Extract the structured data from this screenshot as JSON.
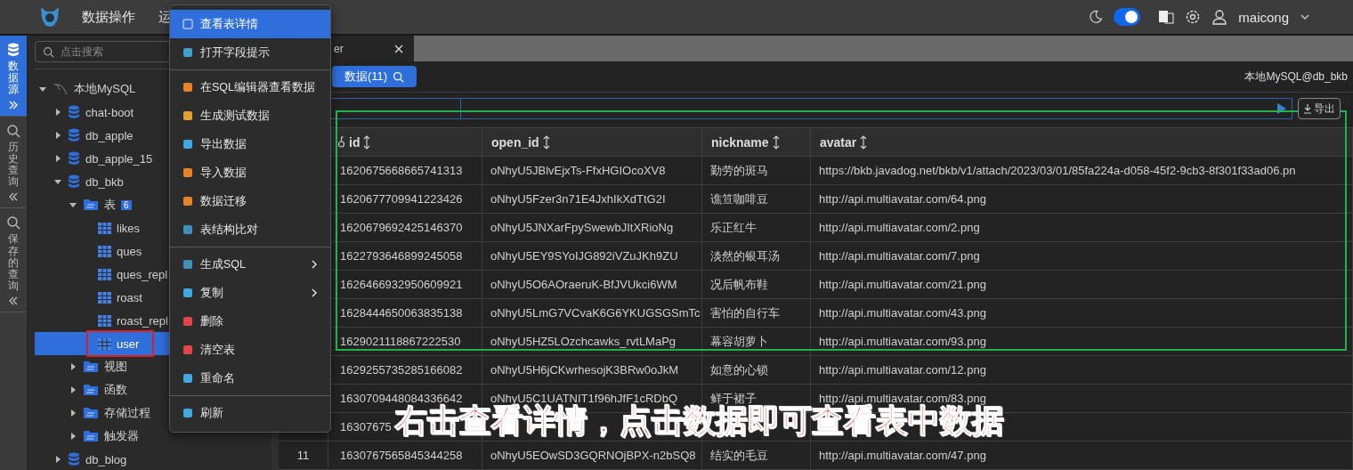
{
  "top_bar": {
    "menu": [
      "数据操作",
      "运"
    ],
    "dark_mode": {
      "on": true
    },
    "user": "maicong"
  },
  "rail": {
    "tabs": [
      {
        "label": "数据源",
        "selected": true
      },
      {
        "label": "历史查询",
        "selected": false
      },
      {
        "label": "保存的查询",
        "selected": false
      }
    ]
  },
  "sidebar": {
    "search": {
      "placeholder": "点击搜索"
    },
    "tree": [
      {
        "label": "本地MySQL",
        "kind": "connection",
        "expanded": true,
        "selected": false,
        "children": [
          {
            "label": "chat-boot",
            "kind": "database",
            "expanded": false,
            "selected": false
          },
          {
            "label": "db_apple",
            "kind": "database",
            "expanded": false,
            "selected": false
          },
          {
            "label": "db_apple_15",
            "kind": "database",
            "expanded": false,
            "selected": false
          },
          {
            "label": "db_bkb",
            "kind": "database",
            "expanded": true,
            "selected": false,
            "children": [
              {
                "label": "表",
                "kind": "folder",
                "badge": "6",
                "expanded": true,
                "selected": false,
                "children": [
                  {
                    "label": "likes",
                    "kind": "table",
                    "selected": false
                  },
                  {
                    "label": "ques",
                    "kind": "table",
                    "selected": false
                  },
                  {
                    "label": "ques_repl",
                    "kind": "table",
                    "selected": false
                  },
                  {
                    "label": "roast",
                    "kind": "table",
                    "selected": false
                  },
                  {
                    "label": "roast_repl",
                    "kind": "table",
                    "selected": false
                  },
                  {
                    "label": "user",
                    "kind": "table",
                    "selected": true
                  }
                ]
              },
              {
                "label": "视图",
                "kind": "folder",
                "expanded": false,
                "selected": false
              },
              {
                "label": "函数",
                "kind": "folder",
                "expanded": false,
                "selected": false
              },
              {
                "label": "存储过程",
                "kind": "folder",
                "expanded": false,
                "selected": false
              },
              {
                "label": "触发器",
                "kind": "folder",
                "expanded": false,
                "selected": false
              }
            ]
          },
          {
            "label": "db_blog",
            "kind": "database",
            "expanded": false,
            "selected": false
          }
        ]
      }
    ]
  },
  "context_menu": {
    "groups": [
      [
        {
          "label": "查看表详情",
          "selected": true,
          "submenu": false
        },
        {
          "label": "打开字段提示",
          "selected": false,
          "submenu": false
        }
      ],
      [
        {
          "label": "在SQL编辑器查看数据",
          "selected": false,
          "submenu": false
        },
        {
          "label": "生成测试数据",
          "selected": false,
          "submenu": false
        },
        {
          "label": "导出数据",
          "selected": false,
          "submenu": false
        },
        {
          "label": "导入数据",
          "selected": false,
          "submenu": false
        },
        {
          "label": "数据迁移",
          "selected": false,
          "submenu": false
        },
        {
          "label": "表结构比对",
          "selected": false,
          "submenu": false
        }
      ],
      [
        {
          "label": "生成SQL",
          "selected": false,
          "submenu": true
        },
        {
          "label": "复制",
          "selected": false,
          "submenu": true
        },
        {
          "label": "删除",
          "selected": false,
          "submenu": false
        },
        {
          "label": "清空表",
          "selected": false,
          "submenu": false
        },
        {
          "label": "重命名",
          "selected": false,
          "submenu": false
        }
      ],
      [
        {
          "label": "刷新",
          "selected": false,
          "submenu": false
        }
      ]
    ]
  },
  "tab": {
    "label": "er"
  },
  "toolbar": {
    "data_button": "数据(11)",
    "connection": "本地MySQL@db_bkb",
    "export_button": "导出"
  },
  "table": {
    "columns": [
      {
        "label": "id",
        "key": true
      },
      {
        "label": "open_id",
        "key": false
      },
      {
        "label": "nickname",
        "key": false
      },
      {
        "label": "avatar",
        "key": false
      }
    ],
    "rows": [
      {
        "cells": [
          "1620675668665741313",
          "oNhyU5JBlvEjxTs-FfxHGIOcoXV8",
          "勤劳的斑马",
          "https://bkb.javadog.net/bkb/v1/attach/2023/03/01/85fa224a-d058-45f2-9cb3-8f301f33ad06.pn"
        ]
      },
      {
        "cells": [
          "1620677709941223426",
          "oNhyU5Fzer3n71E4JxhIkXdTtG2I",
          "谯笪咖啡豆",
          "http://api.multiavatar.com/64.png"
        ]
      },
      {
        "cells": [
          "1620679692425146370",
          "oNhyU5JNXarFpySwewbJItXRioNg",
          "乐正红牛",
          "http://api.multiavatar.com/2.png"
        ]
      },
      {
        "cells": [
          "1622793646899245058",
          "oNhyU5EY9SYoIJG892iVZuJKh9ZU",
          "淡然的银耳汤",
          "http://api.multiavatar.com/7.png"
        ]
      },
      {
        "cells": [
          "1626466932950609921",
          "oNhyU5O6AOraeruK-BfJVUkci6WM",
          "况后帆布鞋",
          "http://api.multiavatar.com/21.png"
        ]
      },
      {
        "cells": [
          "1628444650063835138",
          "oNhyU5LmG7VCvaK6G6YKUGSGSmTc",
          "害怕的自行车",
          "http://api.multiavatar.com/43.png"
        ]
      },
      {
        "cells": [
          "1629021118867222530",
          "oNhyU5HZ5LOzchcawks_rvtLMaPg",
          "幕容胡萝卜",
          "http://api.multiavatar.com/93.png"
        ]
      },
      {
        "cells": [
          "1629255735285166082",
          "oNhyU5H6jCKwrhesojK3BRw0oJkM",
          "如意的心锁",
          "http://api.multiavatar.com/12.png"
        ]
      },
      {
        "cells": [
          "1630709448084336642",
          "oNhyU5C1UATNIT1f96hJfF1cRDbQ",
          "鲜于裙子",
          "http://api.multiavatar.com/83.png"
        ]
      },
      {
        "cells": [
          "16307675"
        ]
      },
      {
        "number": "11",
        "cells": [
          "1630767565845344258",
          "oNhyU5EOwSD3GQRNOjBPX-n2bSQ8",
          "结实的毛豆",
          "http://api.multiavatar.com/47.png"
        ]
      }
    ]
  },
  "annotation": {
    "caption": "右击查看详情，点击数据即可查看表中数据"
  }
}
